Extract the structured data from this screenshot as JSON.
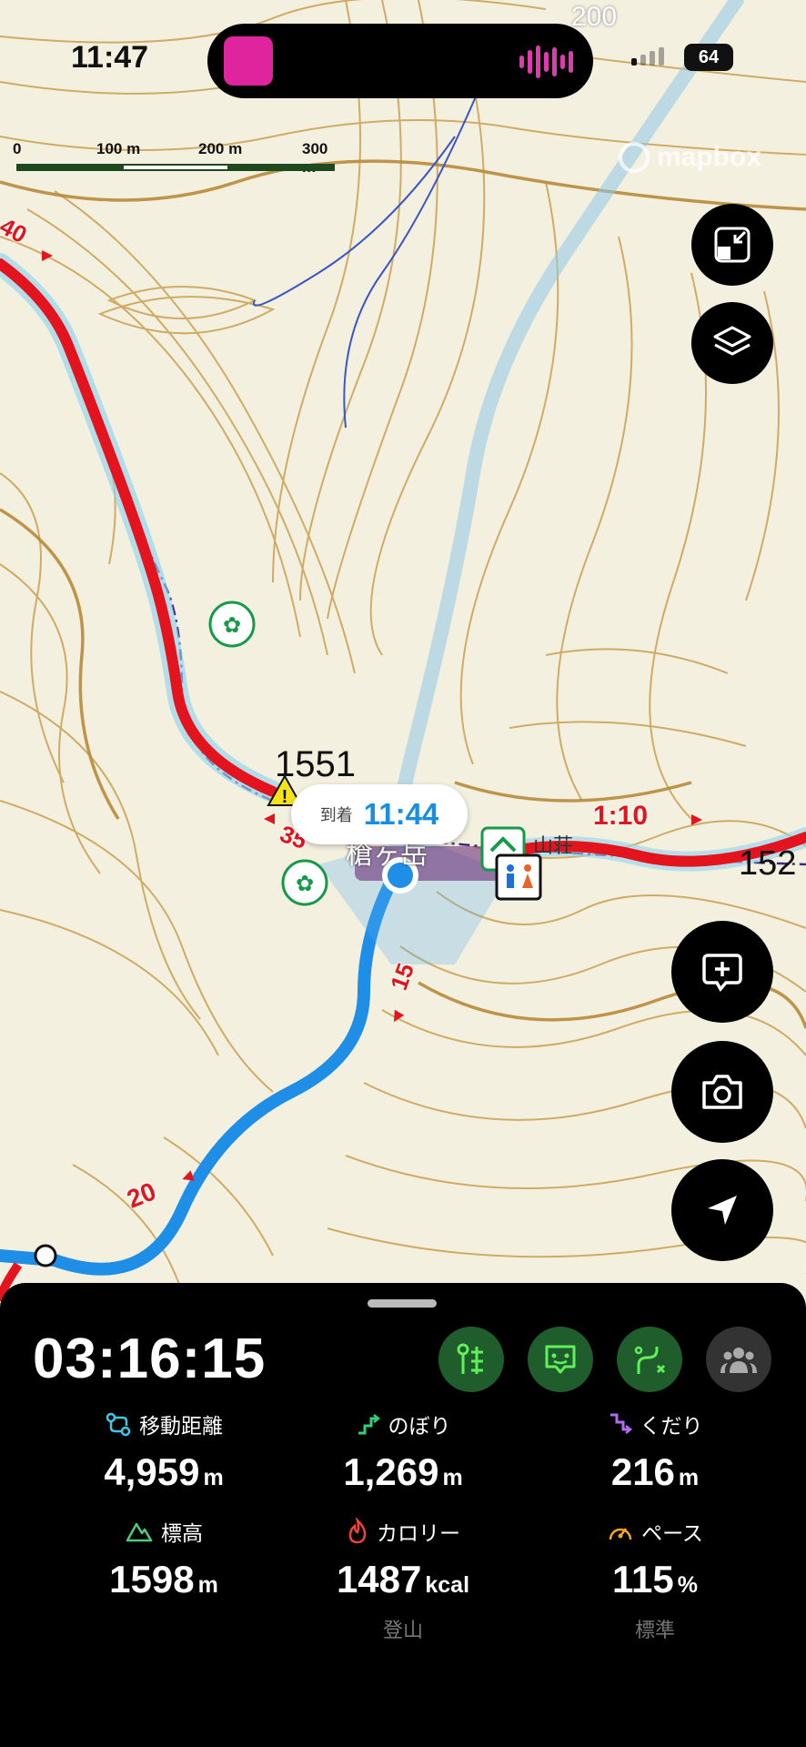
{
  "status_bar": {
    "time": "11:47",
    "battery": "64"
  },
  "map": {
    "attribution": "mapbox",
    "scale": {
      "ticks": [
        "0",
        "100 m",
        "200 m",
        "300 m"
      ]
    },
    "elevation_labels": [
      "1551",
      "152",
      "200"
    ],
    "segment_time_labels": [
      "40",
      "35",
      "15",
      "20",
      "1:10"
    ],
    "place_label": "槍ヶ岳",
    "hut_label": "山荘"
  },
  "arrival": {
    "label": "到着",
    "time": "11:44"
  },
  "panel": {
    "elapsed_time": "03:16:15",
    "stats": [
      {
        "label": "移動距離",
        "value": "4,959",
        "unit": "m",
        "color": "#3ec8e8",
        "icon": "route-distance-icon"
      },
      {
        "label": "のぼり",
        "value": "1,269",
        "unit": "m",
        "color": "#2fd07a",
        "icon": "ascent-icon"
      },
      {
        "label": "くだり",
        "value": "216",
        "unit": "m",
        "color": "#b16cf0",
        "icon": "descent-icon"
      },
      {
        "label": "標高",
        "value": "1598",
        "unit": "m",
        "color": "#4ccc7a",
        "icon": "mountain-icon"
      },
      {
        "label": "カロリー",
        "value": "1487",
        "unit": "kcal",
        "color": "#f0443a",
        "icon": "calorie-flame-icon"
      },
      {
        "label": "ペース",
        "value": "115",
        "unit": "%",
        "color": "#f5a623",
        "icon": "pace-gauge-icon"
      }
    ],
    "calorie_activity": "登山",
    "pace_rating": "標準"
  },
  "colors": {
    "route_red": "#e3141e",
    "track_blue": "#1e8ee6",
    "mode_green_bg": "#1f5e2c",
    "mode_green_icon": "#5ff05a",
    "contour": "#c9a050"
  }
}
